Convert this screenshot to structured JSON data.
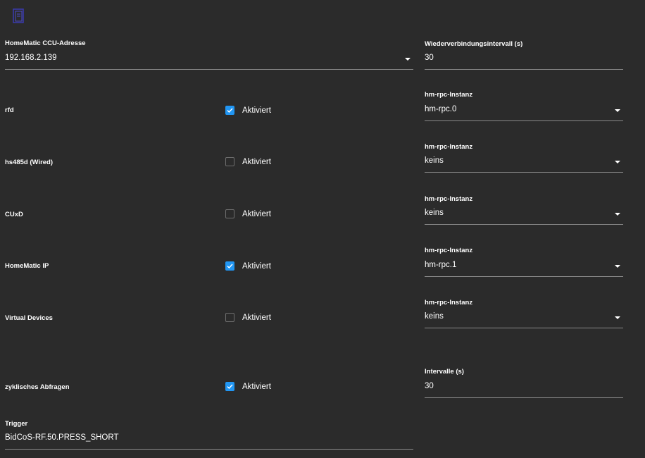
{
  "left": {
    "ccu": {
      "label": "HomeMatic CCU-Adresse",
      "value": "192.168.2.139"
    },
    "rows": [
      {
        "name": "rfd",
        "checked": true,
        "check_label": "Aktiviert"
      },
      {
        "name": "hs485d (Wired)",
        "checked": false,
        "check_label": "Aktiviert"
      },
      {
        "name": "CUxD",
        "checked": false,
        "check_label": "Aktiviert"
      },
      {
        "name": "HomeMatic IP",
        "checked": true,
        "check_label": "Aktiviert"
      },
      {
        "name": "Virtual Devices",
        "checked": false,
        "check_label": "Aktiviert"
      },
      {
        "name": "zyklisches Abfragen",
        "checked": true,
        "check_label": "Aktiviert"
      }
    ],
    "trigger": {
      "label": "Trigger",
      "value": "BidCoS-RF.50.PRESS_SHORT"
    }
  },
  "right": {
    "reconnect": {
      "label": "Wiederverbindungsintervall (s)",
      "value": "30"
    },
    "instances": [
      {
        "label": "hm-rpc-Instanz",
        "value": "hm-rpc.0"
      },
      {
        "label": "hm-rpc-Instanz",
        "value": "keins"
      },
      {
        "label": "hm-rpc-Instanz",
        "value": "keins"
      },
      {
        "label": "hm-rpc-Instanz",
        "value": "hm-rpc.1"
      },
      {
        "label": "hm-rpc-Instanz",
        "value": "keins"
      }
    ],
    "interval": {
      "label": "Intervalle (s)",
      "value": "30"
    }
  },
  "colors": {
    "accent": "#2196f3",
    "background": "#2b2b2b",
    "underline": "#8a8a8a"
  },
  "icons": {
    "logo": "adapter-logo-icon",
    "dropdown": "caret-down-icon",
    "check": "check-icon"
  }
}
